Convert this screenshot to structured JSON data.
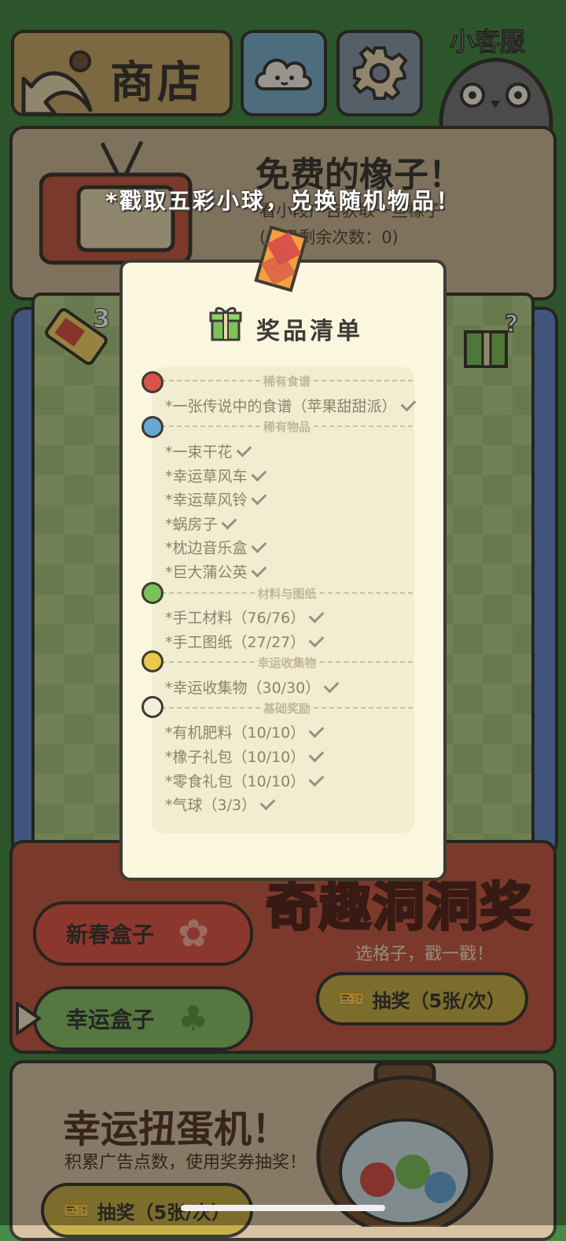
{
  "header": {
    "shop_label": "商店",
    "customer_service_label": "小客服"
  },
  "free_acorn": {
    "title": "免费的橡子！",
    "subtitle": "看小段广告获取一些橡子",
    "remaining": "(今日剩余次数：0)"
  },
  "machine": {
    "ticket_count": "3"
  },
  "overlay": {
    "hint": "*戳取五彩小球，兑换随机物品！",
    "title": "奖品清单",
    "sections": [
      {
        "name": "稀有食谱",
        "color": "#d9534a",
        "items": [
          "*一张传说中的食谱（苹果甜甜派）"
        ]
      },
      {
        "name": "稀有物品",
        "color": "#6aa8d4",
        "items": [
          "*一束干花",
          "*幸运草风车",
          "*幸运草风铃",
          "*蜗房子",
          "*枕边音乐盒",
          "*巨大蒲公英"
        ]
      },
      {
        "name": "材料与图纸",
        "color": "#7cc25a",
        "items": [
          "*手工材料（76/76）",
          "*手工图纸（27/27）"
        ]
      },
      {
        "name": "幸运收集物",
        "color": "#ecc84a",
        "items": [
          "*幸运收集物（30/30）"
        ]
      },
      {
        "name": "基础奖励",
        "color": "#f4eedc",
        "items": [
          "*有机肥料（10/10）",
          "*橡子礼包（10/10）",
          "*零食礼包（10/10）",
          "*气球（3/3）"
        ]
      }
    ]
  },
  "lottery": {
    "title": "奇趣洞洞奖",
    "subtitle": "选格子，戳一戳！",
    "draw_label": "抽奖（5张/次）",
    "spring_box": "新春盒子",
    "lucky_box": "幸运盒子"
  },
  "gacha": {
    "title": "幸运扭蛋机！",
    "subtitle": "积累广告点数，使用奖券抽奖！",
    "draw_label": "抽奖（5张/次）"
  },
  "colors": {
    "accent_red": "#e05a4a",
    "accent_green": "#8ac06a",
    "paper": "#fbf6de"
  }
}
